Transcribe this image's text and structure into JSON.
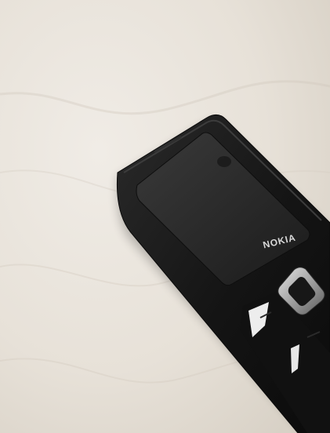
{
  "photo": {
    "subject": "phone",
    "background": "fleece-blanket",
    "colors": {
      "fleece": "#e9e4dc",
      "fleece_shadow": "#d3ccc1",
      "phone_body": "#151515",
      "screen": "#2a2a2a",
      "nav_ring": "#b9b9b9"
    }
  },
  "phone": {
    "brand_text": "NOKIA"
  }
}
